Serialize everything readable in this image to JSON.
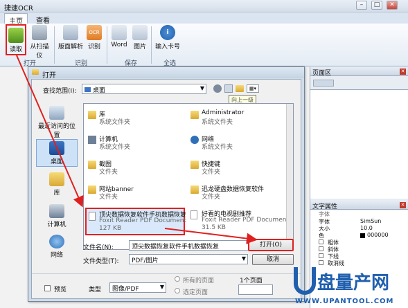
{
  "app": {
    "title": "捷速OCR"
  },
  "tabs": [
    {
      "label": "主页"
    },
    {
      "label": "查看"
    }
  ],
  "ribbon": {
    "buttons": {
      "read": "读取",
      "scan": "从扫描仪",
      "page_analysis": "版面解析",
      "recognize": "识别",
      "word": "Word",
      "image": "图片",
      "import_card": "输入卡号"
    },
    "groups": {
      "open": "打开",
      "recognize": "识别",
      "save": "保存",
      "global": "全选"
    }
  },
  "dialog": {
    "title": "打开",
    "lookin_label": "查找范围(I):",
    "lookin_value": "桌面",
    "tooltip": "向上一级",
    "places": [
      {
        "label": "最近访问的位置"
      },
      {
        "label": "桌面"
      },
      {
        "label": "库"
      },
      {
        "label": "计算机"
      },
      {
        "label": "网络"
      }
    ],
    "files": [
      {
        "name": "库",
        "type": "系统文件夹"
      },
      {
        "name": "Administrator",
        "type": "系统文件夹"
      },
      {
        "name": "计算机",
        "type": "系统文件夹"
      },
      {
        "name": "网络",
        "type": "系统文件夹"
      },
      {
        "name": "截图",
        "type": "文件夹"
      },
      {
        "name": "快捷键",
        "type": "文件夹"
      },
      {
        "name": "网站banner",
        "type": "文件夹"
      },
      {
        "name": "迅龙硬盘数据恢复软件",
        "type": "文件夹"
      },
      {
        "name": "顶尖数据恢复软件手机数据恢复",
        "type": "Foxit Reader PDF Document",
        "size": "127 KB"
      },
      {
        "name": "好看的电视剧推荐",
        "type": "Foxit Reader PDF Document",
        "size": "31.5 KB"
      }
    ],
    "filename_label": "文件名(N):",
    "filename_value": "顶尖数据恢复软件手机数据恢复",
    "filetype_label": "文件类型(T):",
    "filetype_value": "PDF/图片",
    "open_button": "打开(O)",
    "cancel_button": "取消",
    "preview_label": "预览",
    "type_label": "类型",
    "type_value": "图像/PDF",
    "all_pages_label": "所有的页面",
    "selected_pages_label": "选定页面",
    "page_count": "1个页面"
  },
  "right_panel": {
    "pages_title": "页面区",
    "text_props_title": "文字属性",
    "props": {
      "heading": "字体",
      "font_label": "字体",
      "font_value": "SimSun",
      "size_label": "大小",
      "size_value": "10.0",
      "color_label": "色",
      "color_value": "000000",
      "bold": "粗体",
      "italic": "斜体",
      "underline": "下线",
      "strike": "取消线"
    }
  },
  "watermark": {
    "text": "盘量产网",
    "url": "WWW.UPANTOOL.COM"
  },
  "colors": {
    "highlight": "#e02020",
    "accent": "#1f5fae"
  }
}
